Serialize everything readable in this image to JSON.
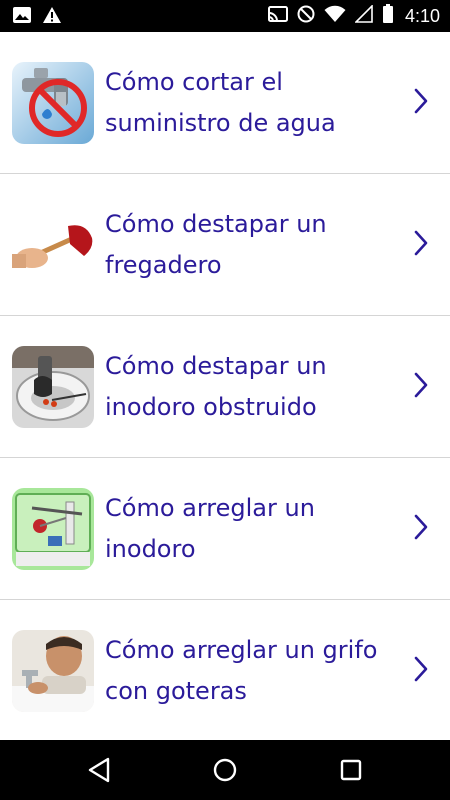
{
  "status_bar": {
    "time": "4:10",
    "icons_left": [
      "image-icon",
      "warning-icon"
    ],
    "icons_right": [
      "cast-icon",
      "do-not-disturb-icon",
      "wifi-icon",
      "signal-icon",
      "battery-icon"
    ]
  },
  "list": {
    "items": [
      {
        "label": "Cómo cortar el suministro de agua",
        "thumbnail": "faucet-no-water"
      },
      {
        "label": "Cómo destapar un fregadero",
        "thumbnail": "plunger"
      },
      {
        "label": "Cómo destapar un inodoro obstruido",
        "thumbnail": "toilet-unclog"
      },
      {
        "label": "Cómo arreglar un inodoro",
        "thumbnail": "toilet-tank"
      },
      {
        "label": "Cómo arreglar un grifo con goteras",
        "thumbnail": "plumber-faucet"
      }
    ]
  },
  "nav_bar": {
    "buttons": [
      "back",
      "home",
      "recents"
    ]
  },
  "colors": {
    "accent": "#2b1b9a",
    "divider": "#d5d5d5"
  }
}
